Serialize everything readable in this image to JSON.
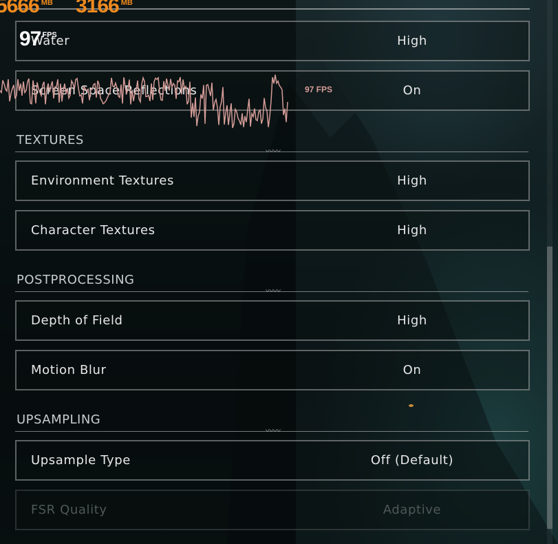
{
  "overlay": {
    "mem1": "5666",
    "mem2": "3166",
    "mem_unit": "MB",
    "fps_value": "97",
    "fps_unit": "FPS",
    "graph_label": "97 FPS"
  },
  "rows_top": [
    {
      "label": "Water",
      "value": "High"
    },
    {
      "label": "Screen Space Reflections",
      "value": "On"
    }
  ],
  "sections": {
    "textures": {
      "title": "TEXTURES",
      "rows": [
        {
          "label": "Environment Textures",
          "value": "High"
        },
        {
          "label": "Character Textures",
          "value": "High"
        }
      ]
    },
    "postprocessing": {
      "title": "POSTPROCESSING",
      "rows": [
        {
          "label": "Depth of Field",
          "value": "High"
        },
        {
          "label": "Motion Blur",
          "value": "On"
        }
      ]
    },
    "upsampling": {
      "title": "UPSAMPLING",
      "rows": [
        {
          "label": "Upsample Type",
          "value": "Off (Default)"
        },
        {
          "label": "FSR Quality",
          "value": "Adaptive"
        }
      ]
    }
  },
  "colors": {
    "overlay_orange": "#f08a1e",
    "graph_pink": "#d49c98",
    "text": "#e8e8e8",
    "disabled_text": "#4f5757"
  }
}
